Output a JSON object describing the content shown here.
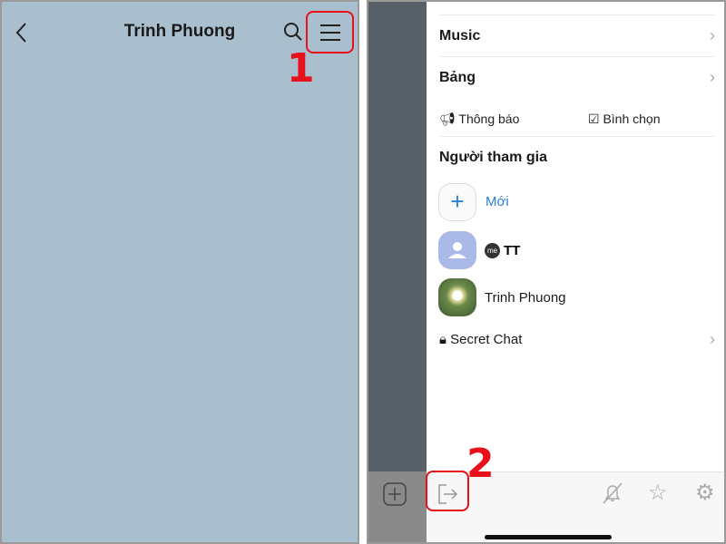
{
  "left": {
    "title": "Trinh Phuong",
    "step": "1",
    "icons": [
      "back-chevron-icon",
      "search-icon",
      "menu-icon"
    ]
  },
  "drawer": {
    "music": "Music",
    "board": "Bảng",
    "notice": "Thông báo",
    "poll": "Bình chọn",
    "members_heading": "Người tham gia",
    "add_new": "Mới",
    "members": [
      {
        "badge": "me",
        "name": "TT"
      },
      {
        "name": "Trinh Phuong"
      }
    ],
    "secret_chat": "Secret Chat"
  },
  "bottom": {
    "step": "2",
    "icons": [
      "leave-icon",
      "mute-bell-icon",
      "star-icon",
      "gear-icon"
    ]
  },
  "colors": {
    "highlight": "#e8101a",
    "accent": "#2b7fd4",
    "chat_bg": "#a9bfcd"
  }
}
